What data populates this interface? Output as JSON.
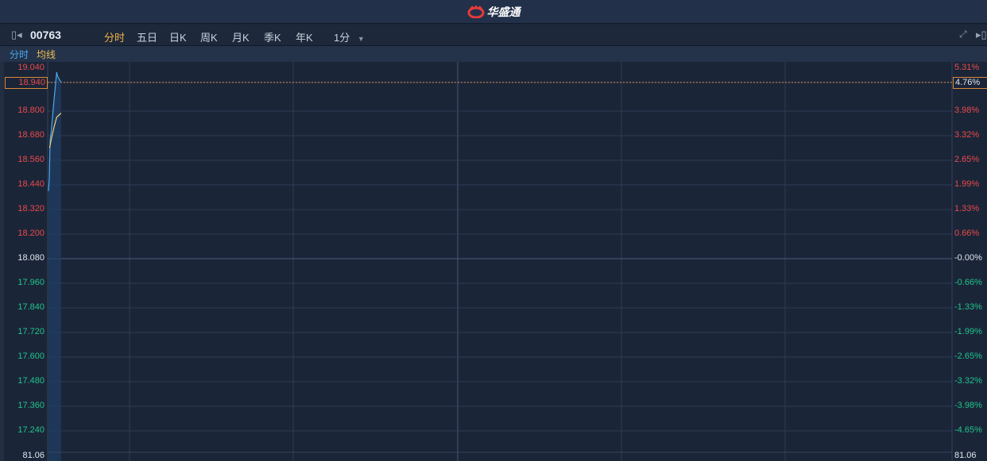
{
  "app": {
    "logo_text": "华盛通"
  },
  "toolbar": {
    "code": "00763",
    "tabs": [
      "分时",
      "五日",
      "日K",
      "周K",
      "月K",
      "季K",
      "年K"
    ],
    "active_tab": "分时",
    "interval": "1分"
  },
  "subbar": {
    "items": [
      "分时",
      "均线"
    ]
  },
  "axis": {
    "left": [
      "19.040",
      "18.940",
      "18.800",
      "18.680",
      "18.560",
      "18.440",
      "18.320",
      "18.200",
      "18.080",
      "17.960",
      "17.840",
      "17.720",
      "17.600",
      "17.480",
      "17.360",
      "17.240"
    ],
    "right": [
      "5.31%",
      "4.76%",
      "3.98%",
      "3.32%",
      "2.65%",
      "1.99%",
      "1.33%",
      "0.66%",
      "-0.00%",
      "-0.66%",
      "-1.33%",
      "-1.99%",
      "-2.65%",
      "-3.32%",
      "-3.98%",
      "-4.65%"
    ],
    "volume_left": "81.06",
    "volume_right": "81.06"
  },
  "colors": {
    "up": "#e84a4a",
    "down": "#1fc48a",
    "price": "#4aa8f0",
    "avg": "#f0d070",
    "highlight": "#d98a3a"
  },
  "chart_data": {
    "type": "line",
    "prev_close": 18.08,
    "ylim": [
      17.12,
      19.04
    ],
    "total_minutes": 330,
    "current_price": 18.94,
    "series": [
      {
        "name": "分时",
        "minutes": [
          0,
          0.3,
          0.6,
          1,
          2,
          3,
          3.3,
          4.6
        ],
        "values": [
          18.41,
          18.47,
          18.66,
          18.7,
          18.85,
          18.99,
          18.97,
          18.94
        ]
      },
      {
        "name": "均线",
        "minutes": [
          0.4,
          1,
          2,
          3,
          4.6
        ],
        "values": [
          18.62,
          18.66,
          18.72,
          18.77,
          18.79
        ]
      }
    ]
  }
}
